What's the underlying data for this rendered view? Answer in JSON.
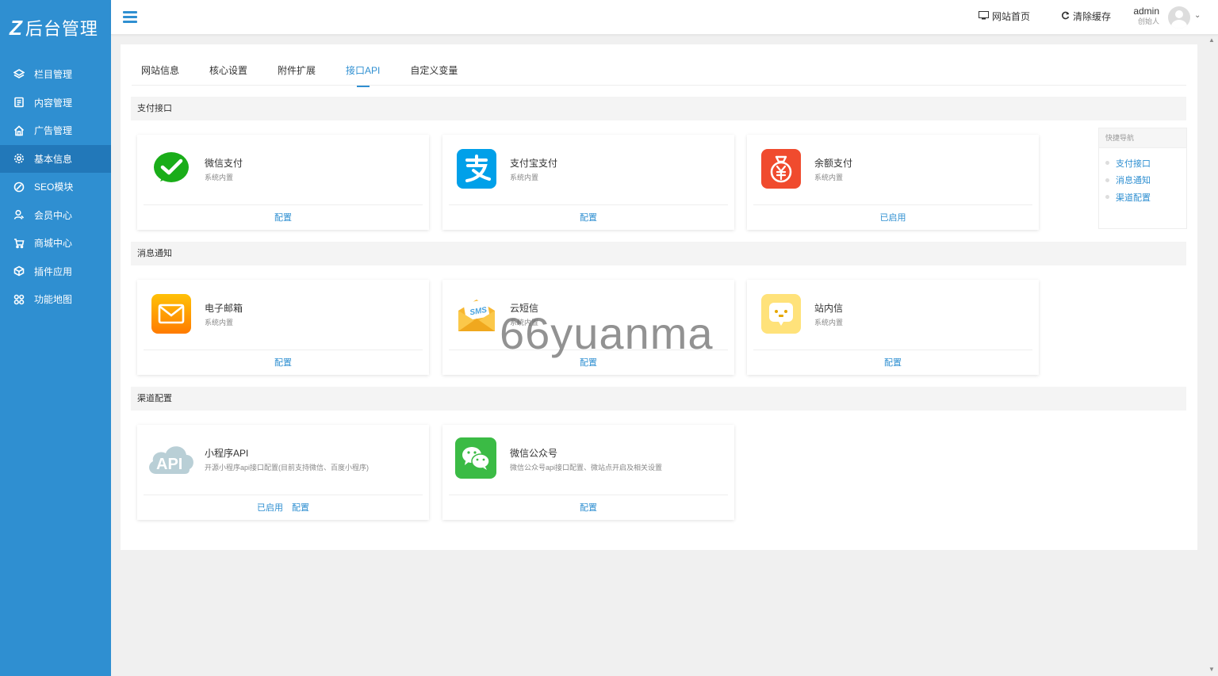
{
  "app": {
    "logo_mark": "Z",
    "logo_text": "后台管理"
  },
  "sidebar": {
    "items": [
      {
        "label": "栏目管理",
        "icon": "layers-icon"
      },
      {
        "label": "内容管理",
        "icon": "document-icon"
      },
      {
        "label": "广告管理",
        "icon": "home-icon"
      },
      {
        "label": "基本信息",
        "icon": "gear-icon",
        "active": true
      },
      {
        "label": "SEO模块",
        "icon": "compass-icon"
      },
      {
        "label": "会员中心",
        "icon": "user-icon"
      },
      {
        "label": "商城中心",
        "icon": "cart-icon"
      },
      {
        "label": "插件应用",
        "icon": "cube-icon"
      },
      {
        "label": "功能地图",
        "icon": "grid-icon"
      }
    ]
  },
  "header": {
    "home_label": "网站首页",
    "clear_cache_label": "清除缓存",
    "user_name": "admin",
    "user_role": "创始人"
  },
  "tabs": [
    {
      "label": "网站信息"
    },
    {
      "label": "核心设置"
    },
    {
      "label": "附件扩展"
    },
    {
      "label": "接口API",
      "active": true
    },
    {
      "label": "自定义变量"
    }
  ],
  "sections": {
    "payment": "支付接口",
    "notify": "消息通知",
    "channel": "渠道配置"
  },
  "cards": {
    "wechat_pay": {
      "title": "微信支付",
      "desc": "系统内置",
      "action": "配置"
    },
    "alipay": {
      "title": "支付宝支付",
      "desc": "系统内置",
      "action": "配置"
    },
    "balance_pay": {
      "title": "余额支付",
      "desc": "系统内置",
      "action": "已启用"
    },
    "email": {
      "title": "电子邮箱",
      "desc": "系统内置",
      "action": "配置"
    },
    "sms": {
      "title": "云短信",
      "desc": "系统内置",
      "action": "配置"
    },
    "inbox": {
      "title": "站内信",
      "desc": "系统内置",
      "action": "配置"
    },
    "miniapp": {
      "title": "小程序API",
      "desc": "开源小程序api接口配置(目前支持微信、百度小程序)",
      "action_enabled": "已启用",
      "action": "配置",
      "icon_text": "API"
    },
    "wechat_mp": {
      "title": "微信公众号",
      "desc": "微信公众号api接口配置、微站点开启及相关设置",
      "action": "配置"
    }
  },
  "quicknav": {
    "title": "快捷导航",
    "items": [
      {
        "label": "支付接口"
      },
      {
        "label": "消息通知"
      },
      {
        "label": "渠道配置"
      }
    ]
  },
  "watermark": "66yuanma",
  "colors": {
    "primary": "#2f8fd1",
    "sidebar_active": "#2278b9"
  }
}
